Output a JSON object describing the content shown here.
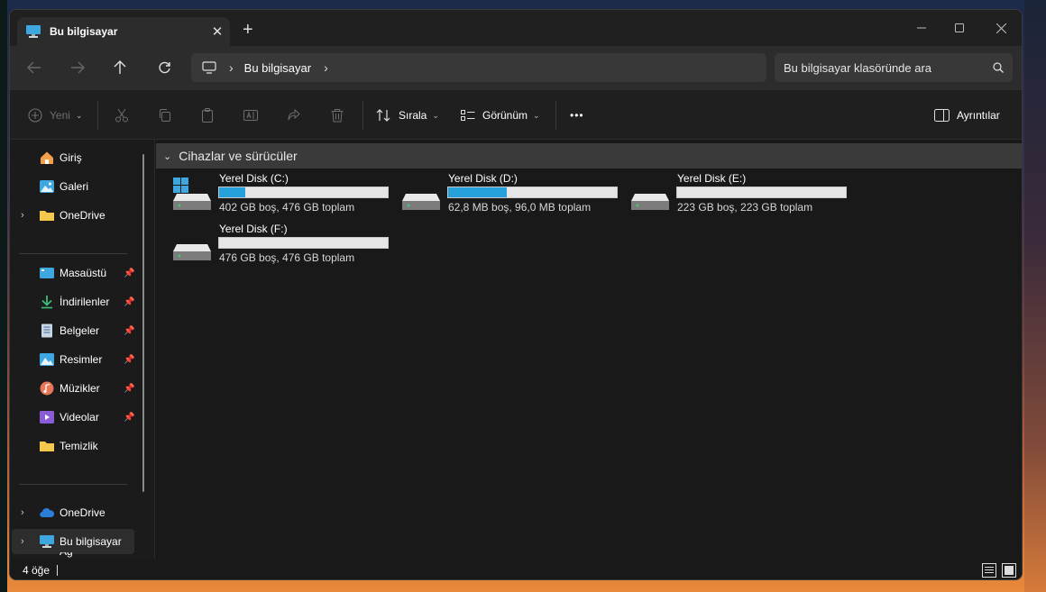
{
  "window": {
    "tab_title": "Bu bilgisayar",
    "new_tab_glyph": "+",
    "close_tab_glyph": "✕"
  },
  "nav": {
    "breadcrumb": [
      "Bu bilgisayar"
    ],
    "search_placeholder": "Bu bilgisayar klasöründe ara"
  },
  "toolbar": {
    "new_label": "Yeni",
    "sort_label": "Sırala",
    "view_label": "Görünüm",
    "more_label": "•••",
    "details_label": "Ayrıntılar"
  },
  "sidebar": {
    "items": [
      {
        "label": "Giriş",
        "icon": "home-icon"
      },
      {
        "label": "Galeri",
        "icon": "gallery-icon"
      },
      {
        "label": "OneDrive",
        "icon": "folder-icon"
      },
      {
        "label": "Masaüstü",
        "icon": "desktop-icon"
      },
      {
        "label": "İndirilenler",
        "icon": "download-icon"
      },
      {
        "label": "Belgeler",
        "icon": "documents-icon"
      },
      {
        "label": "Resimler",
        "icon": "pictures-icon"
      },
      {
        "label": "Müzikler",
        "icon": "music-icon"
      },
      {
        "label": "Videolar",
        "icon": "videos-icon"
      },
      {
        "label": "Temizlik",
        "icon": "folder-icon"
      },
      {
        "label": "OneDrive",
        "icon": "cloud-icon"
      },
      {
        "label": "Bu bilgisayar",
        "icon": "pc-icon"
      },
      {
        "label": "Ağ",
        "icon": "network-icon"
      }
    ]
  },
  "content": {
    "group_title": "Cihazlar ve sürücüler",
    "drives": [
      {
        "name": "Yerel Disk (C:)",
        "info": "402 GB boş, 476 GB toplam",
        "used_fraction": 0.155,
        "bar_color": "#26a0da"
      },
      {
        "name": "Yerel Disk (D:)",
        "info": "62,8 MB boş, 96,0 MB toplam",
        "used_fraction": 0.35,
        "bar_color": "#26a0da"
      },
      {
        "name": "Yerel Disk (E:)",
        "info": "223 GB boş, 223 GB toplam",
        "used_fraction": 0.0,
        "bar_color": "#26a0da"
      },
      {
        "name": "Yerel Disk (F:)",
        "info": "476 GB boş, 476 GB toplam",
        "used_fraction": 0.0,
        "bar_color": "#26a0da"
      }
    ]
  },
  "status": {
    "item_count": "4 öğe"
  },
  "colors": {
    "accent": "#26a0da",
    "folder": "#f2c94c",
    "window_bg": "#191919"
  }
}
